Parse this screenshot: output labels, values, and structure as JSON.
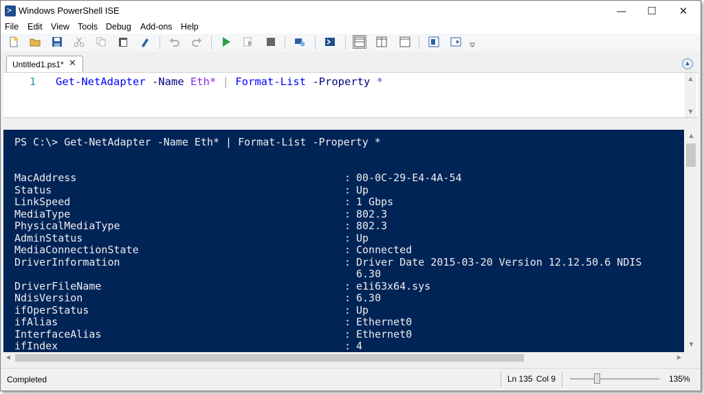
{
  "window": {
    "title": "Windows PowerShell ISE",
    "minimize_icon": "minimize-icon",
    "maximize_icon": "maximize-icon",
    "close_icon": "close-icon"
  },
  "menu": [
    "File",
    "Edit",
    "View",
    "Tools",
    "Debug",
    "Add-ons",
    "Help"
  ],
  "toolbar_icons": [
    "new-file-icon",
    "open-folder-icon",
    "save-icon",
    "cut-icon",
    "copy-icon",
    "paste-icon",
    "clear-console-icon",
    "undo-icon",
    "redo-icon",
    "run-script-icon",
    "run-selection-icon",
    "stop-icon",
    "new-remote-tab-icon",
    "start-powershell-icon",
    "show-script-pane-top-icon",
    "show-script-pane-right-icon",
    "show-script-pane-maximized-icon",
    "show-command-window-icon",
    "show-command-addon-icon",
    "toolbar-overflow-icon"
  ],
  "tab": {
    "label": "Untitled1.ps1*",
    "close": "✕"
  },
  "editor": {
    "line_number": "1",
    "tokens": [
      {
        "text": "Get-NetAdapter",
        "color": "#0000ff"
      },
      {
        "text": " ",
        "color": "#000000"
      },
      {
        "text": "-Name",
        "color": "#000080"
      },
      {
        "text": " ",
        "color": "#000000"
      },
      {
        "text": "Eth*",
        "color": "#8a2be2"
      },
      {
        "text": " | ",
        "color": "#a9a9a9"
      },
      {
        "text": "Format-List",
        "color": "#0000ff"
      },
      {
        "text": " ",
        "color": "#000000"
      },
      {
        "text": "-Property",
        "color": "#000080"
      },
      {
        "text": " ",
        "color": "#000000"
      },
      {
        "text": "*",
        "color": "#8a2be2"
      }
    ]
  },
  "console": {
    "prompt_line": "PS C:\\> Get-NetAdapter -Name Eth* | Format-List -Property *",
    "separator": ":",
    "properties": [
      {
        "name": "MacAddress",
        "value": "00-0C-29-E4-4A-54"
      },
      {
        "name": "Status",
        "value": "Up"
      },
      {
        "name": "LinkSpeed",
        "value": "1 Gbps"
      },
      {
        "name": "MediaType",
        "value": "802.3"
      },
      {
        "name": "PhysicalMediaType",
        "value": "802.3"
      },
      {
        "name": "AdminStatus",
        "value": "Up"
      },
      {
        "name": "MediaConnectionState",
        "value": "Connected"
      },
      {
        "name": "DriverInformation",
        "value": "Driver Date 2015-03-20 Version 12.12.50.6 NDIS",
        "continuation": "6.30"
      },
      {
        "name": "DriverFileName",
        "value": "e1i63x64.sys"
      },
      {
        "name": "NdisVersion",
        "value": "6.30"
      },
      {
        "name": "ifOperStatus",
        "value": "Up"
      },
      {
        "name": "ifAlias",
        "value": "Ethernet0"
      },
      {
        "name": "InterfaceAlias",
        "value": "Ethernet0"
      },
      {
        "name": "ifIndex",
        "value": "4"
      }
    ]
  },
  "status": {
    "text": "Completed",
    "ln": "Ln 135",
    "col": "Col 9",
    "zoom": "135%"
  }
}
